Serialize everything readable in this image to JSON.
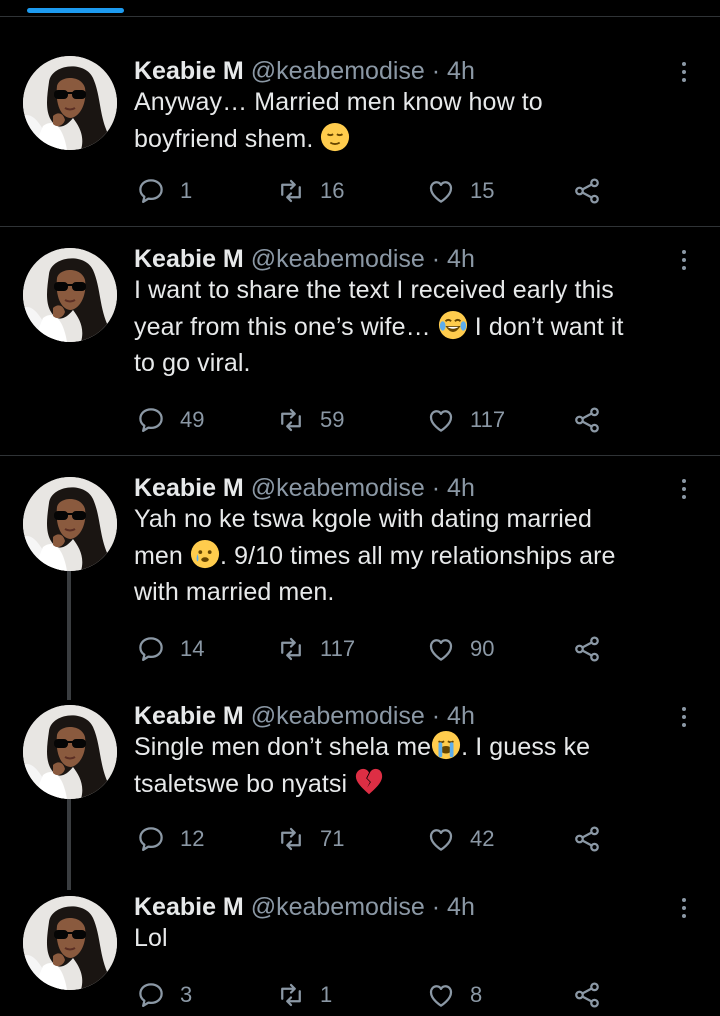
{
  "tweets": [
    {
      "name": "Keabie M",
      "handle": "@keabemodise",
      "dot": "·",
      "time": "4h",
      "lines": [
        "Anyway… Married men know how to",
        "boyfriend shem."
      ],
      "replies": "1",
      "retweets": "16",
      "likes": "15"
    },
    {
      "name": "Keabie M",
      "handle": "@keabemodise",
      "dot": "·",
      "time": "4h",
      "lines": [
        "I want to share the text I received early this",
        "year from this one’s wife…",
        "I don’t want it",
        "to go viral."
      ],
      "replies": "49",
      "retweets": "59",
      "likes": "117"
    },
    {
      "name": "Keabie M",
      "handle": "@keabemodise",
      "dot": "·",
      "time": "4h",
      "lines": [
        "Yah no ke tswa kgole with dating married",
        "men",
        ". 9/10 times all my relationships are",
        "with married men."
      ],
      "replies": "14",
      "retweets": "117",
      "likes": "90"
    },
    {
      "name": "Keabie M",
      "handle": "@keabemodise",
      "dot": "·",
      "time": "4h",
      "lines": [
        "Single men don’t shela me",
        ". I guess ke",
        "tsaletswe bo nyatsi"
      ],
      "replies": "12",
      "retweets": "71",
      "likes": "42"
    },
    {
      "name": "Keabie M",
      "handle": "@keabemodise",
      "dot": "·",
      "time": "4h",
      "lines": [
        "Lol"
      ],
      "replies": "3",
      "retweets": "1",
      "likes": "8"
    }
  ],
  "icons": {
    "reply": "reply-icon",
    "retweet": "retweet-icon",
    "like": "heart-icon",
    "share": "share-icon",
    "more": "more-options-icon",
    "emoji_relieved": "relieved-face-emoji",
    "emoji_joy": "tears-of-joy-emoji",
    "emoji_sad": "sad-sweat-face-emoji",
    "emoji_cry": "loudly-crying-emoji",
    "emoji_broken_heart": "broken-heart-emoji"
  },
  "colors": {
    "background": "#000000",
    "text": "#e7e9ea",
    "muted": "#8b98a5",
    "accent": "#1d9bf0",
    "divider": "#2f3336"
  }
}
